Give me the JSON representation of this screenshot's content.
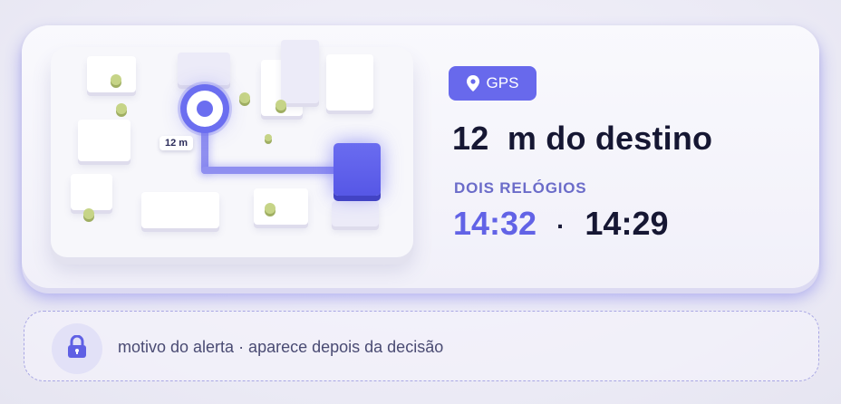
{
  "map": {
    "distance_tag": "12 m"
  },
  "badge": {
    "label": "GPS",
    "icon": "location-pin-icon",
    "color": "#6869ec"
  },
  "headline": "12  m do destino",
  "clocks": {
    "label": "DOIS RELÓGIOS",
    "time_a": "14:32",
    "separator": "·",
    "time_b": "14:29",
    "time_a_color": "#6263e6"
  },
  "alert": {
    "icon": "lock-icon",
    "text": "motivo do alerta · aparece depois da decisão"
  }
}
